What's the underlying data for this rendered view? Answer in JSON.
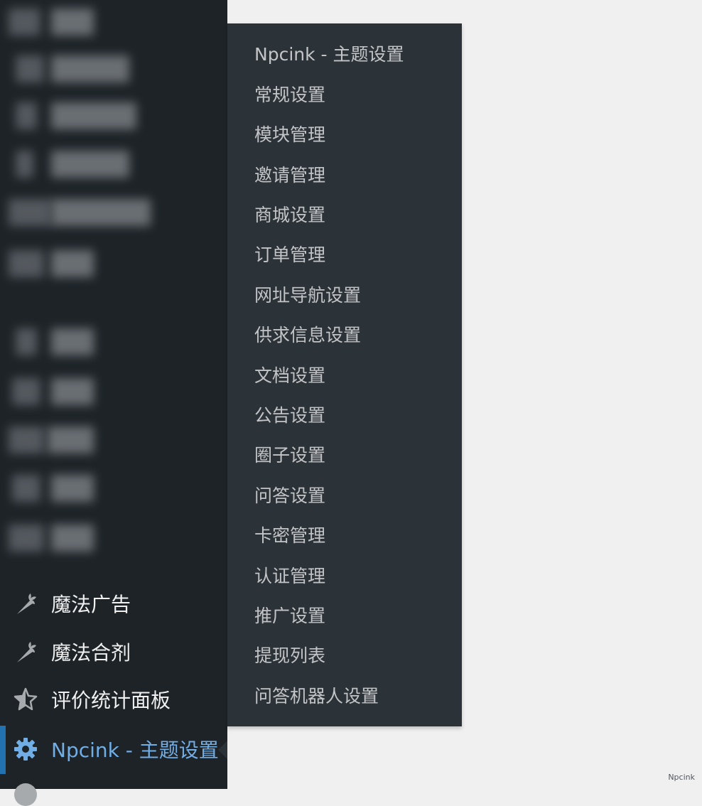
{
  "sidebar": {
    "menu": [
      {
        "label": "魔法广告",
        "icon": "carrot-icon"
      },
      {
        "label": "魔法合剂",
        "icon": "carrot-icon"
      },
      {
        "label": "评价统计面板",
        "icon": "star-half-icon"
      },
      {
        "label": "Npcink - 主题设置",
        "icon": "gear-icon",
        "current": true
      }
    ]
  },
  "flyout": {
    "title": "Npcink - 主题设置",
    "items": [
      "常规设置",
      "模块管理",
      "邀请管理",
      "商城设置",
      "订单管理",
      "网址导航设置",
      "供求信息设置",
      "文档设置",
      "公告设置",
      "圈子设置",
      "问答设置",
      "卡密管理",
      "认证管理",
      "推广设置",
      "提现列表",
      "问答机器人设置"
    ]
  },
  "watermark": "Npcink",
  "colors": {
    "sidebar_bg": "#1d2327",
    "flyout_bg": "#2c3338",
    "accent": "#72aee6",
    "current_bar": "#2271b1"
  }
}
